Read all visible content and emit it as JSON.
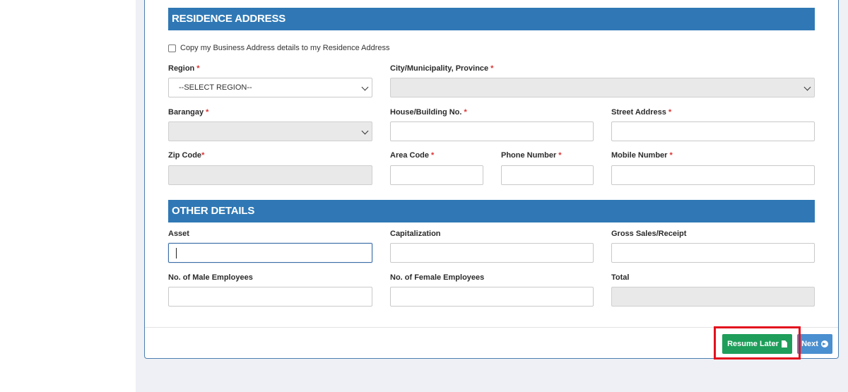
{
  "residence": {
    "title": "RESIDENCE ADDRESS",
    "copy_label": "Copy my Business Address details to my Residence Address",
    "copy_checked": false,
    "region_label": "Region",
    "region_value": "--SELECT REGION--",
    "city_label": "City/Municipality, Province",
    "barangay_label": "Barangay",
    "house_label": "House/Building No.",
    "street_label": "Street Address",
    "zip_label": "Zip Code",
    "area_label": "Area Code",
    "phone_label": "Phone Number",
    "mobile_label": "Mobile Number",
    "required_mark": "*"
  },
  "other": {
    "title": "OTHER DETAILS",
    "asset_label": "Asset",
    "capitalization_label": "Capitalization",
    "gross_label": "Gross Sales/Receipt",
    "male_label": "No. of Male Employees",
    "female_label": "No. of Female Employees",
    "total_label": "Total"
  },
  "actions": {
    "resume_label": "Resume Later",
    "resume_icon": "document-icon",
    "next_label": "Next",
    "next_icon": "arrow-circle-right-icon"
  },
  "colors": {
    "section_bar": "#2f78b5",
    "resume_button": "#1e9e5a",
    "next_button": "#4a8fd0",
    "highlight_box": "#e3101d",
    "required": "#dd3333"
  }
}
